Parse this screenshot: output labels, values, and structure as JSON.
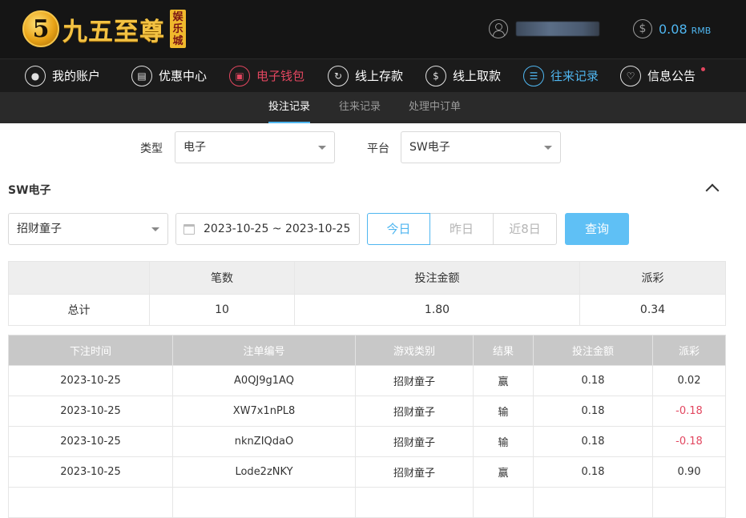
{
  "brand": {
    "logo_glyph": "5",
    "name": "九五至尊",
    "sub": [
      "娱",
      "乐",
      "城"
    ]
  },
  "account": {
    "balance": "0.08",
    "currency": "RMB"
  },
  "nav": [
    {
      "label": "我的账户",
      "icon": "user-icon"
    },
    {
      "label": "优惠中心",
      "icon": "gift-icon"
    },
    {
      "label": "电子钱包",
      "icon": "wallet-icon"
    },
    {
      "label": "线上存款",
      "icon": "deposit-icon"
    },
    {
      "label": "线上取款",
      "icon": "withdraw-icon"
    },
    {
      "label": "往来记录",
      "icon": "records-icon"
    },
    {
      "label": "信息公告",
      "icon": "bell-icon"
    }
  ],
  "subtabs": [
    "投注记录",
    "往来记录",
    "处理中订单"
  ],
  "filters": {
    "type_label": "类型",
    "type_value": "电子",
    "platform_label": "平台",
    "platform_value": "SW电子"
  },
  "section": {
    "title": "SW电子",
    "game_value": "招财童子",
    "date_range": "2023-10-25 ~ 2023-10-25",
    "quick_ranges": [
      "今日",
      "昨日",
      "近8日"
    ],
    "query_label": "查询"
  },
  "summary": {
    "headers": [
      "",
      "笔数",
      "投注金额",
      "派彩"
    ],
    "row": [
      "总计",
      "10",
      "1.80",
      "0.34"
    ]
  },
  "records": {
    "headers": [
      "下注时间",
      "注单编号",
      "游戏类别",
      "结果",
      "投注金额",
      "派彩"
    ],
    "rows": [
      [
        "2023-10-25",
        "A0QJ9g1AQ",
        "招财童子",
        "赢",
        "0.18",
        "0.02"
      ],
      [
        "2023-10-25",
        "XW7x1nPL8",
        "招财童子",
        "输",
        "0.18",
        "-0.18"
      ],
      [
        "2023-10-25",
        "nknZIQdaO",
        "招财童子",
        "输",
        "0.18",
        "-0.18"
      ],
      [
        "2023-10-25",
        "Lode2zNKY",
        "招财童子",
        "赢",
        "0.18",
        "0.90"
      ],
      [
        "",
        "",
        "",
        "",
        "",
        ""
      ]
    ]
  },
  "colors": {
    "accent": "#4fb6f0",
    "wallet": "#e2465f",
    "negative": "#e2465f",
    "gold": "#f3c243"
  }
}
